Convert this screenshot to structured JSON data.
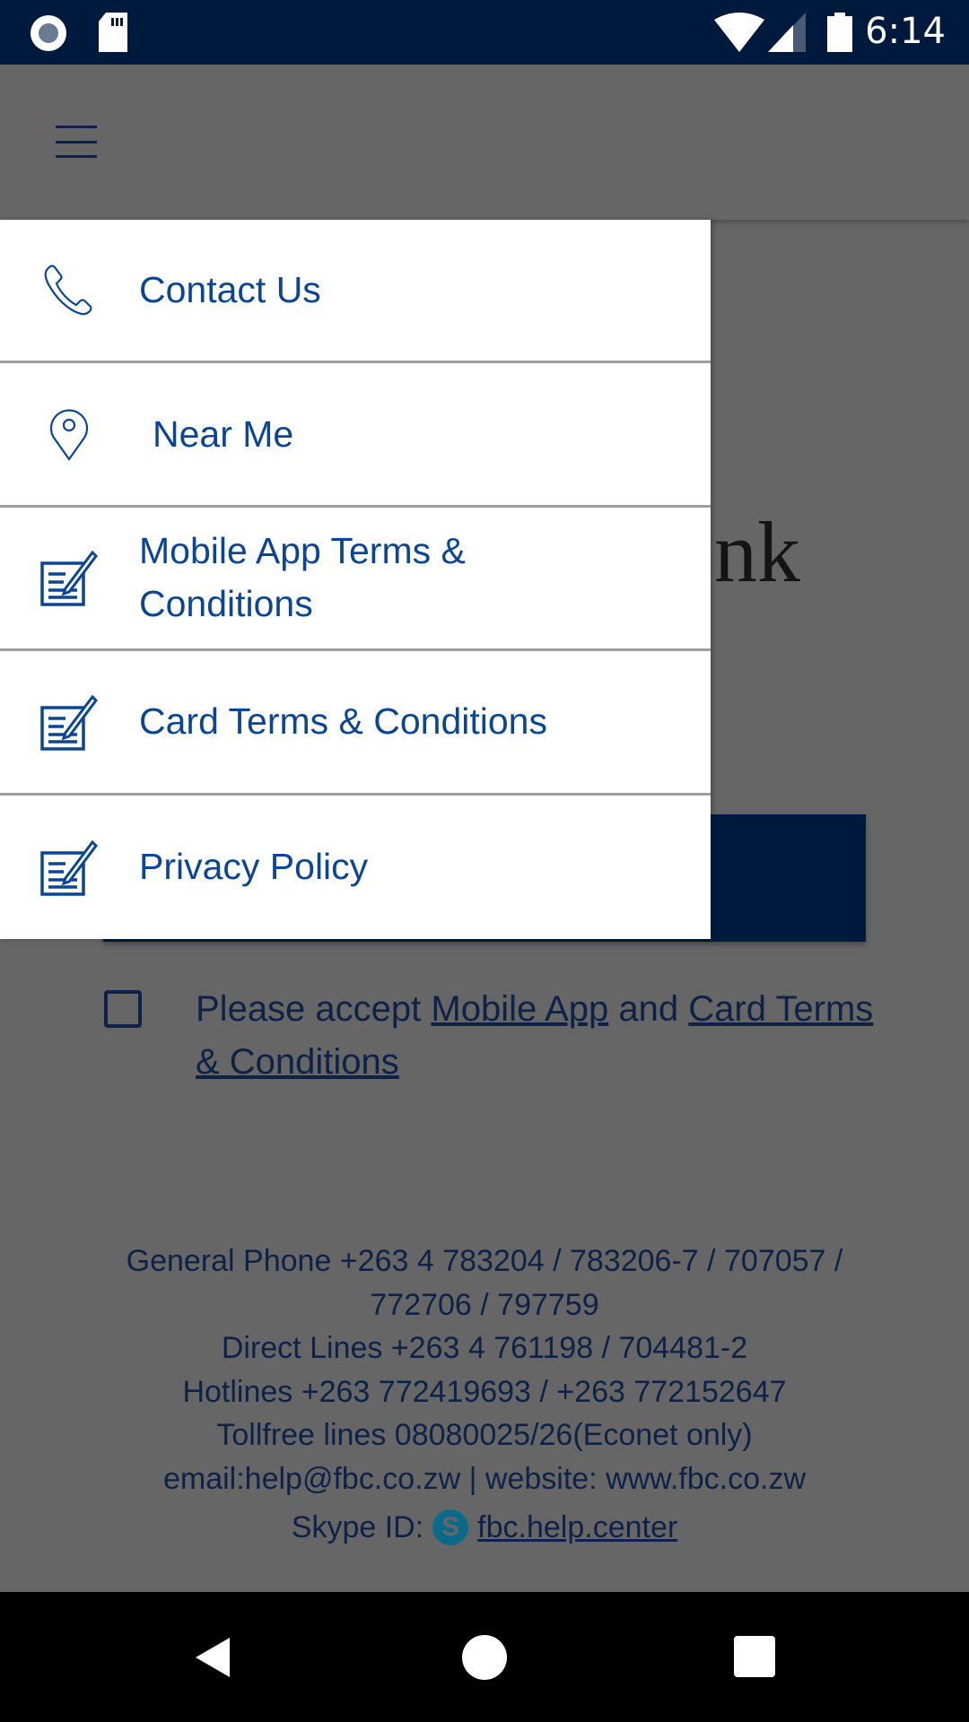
{
  "status_bar": {
    "time": "6:14",
    "icons": [
      "camera-record-icon",
      "sd-card-icon",
      "wifi-icon",
      "signal-icon",
      "battery-icon"
    ]
  },
  "toolbar": {
    "menu_icon": "hamburger-icon"
  },
  "background": {
    "title_fragment": "nk",
    "accept_prefix": "Please accept ",
    "accept_link1": "Mobile App",
    "accept_mid": " and ",
    "accept_link2": "Card Terms & Conditions"
  },
  "footer": {
    "lines": [
      "General Phone +263 4 783204 / 783206-7 / 707057 / 772706 / 797759",
      "Direct Lines +263 4 761198 / 704481-2",
      "Hotlines +263 772419693 / +263 772152647",
      "Tollfree lines 08080025/26(Econet only)",
      "email:help@fbc.co.zw | website: www.fbc.co.zw"
    ],
    "skype_label": "Skype ID:",
    "skype_id": "fbc.help.center"
  },
  "drawer": {
    "items": [
      {
        "label": "Contact Us",
        "icon": "phone-icon"
      },
      {
        "label": "Near Me",
        "icon": "location-pin-icon"
      },
      {
        "label": "Mobile App Terms & Conditions",
        "icon": "document-edit-icon"
      },
      {
        "label": "Card Terms & Conditions",
        "icon": "document-edit-icon"
      },
      {
        "label": "Privacy Policy",
        "icon": "document-edit-icon"
      }
    ]
  },
  "colors": {
    "status_bar": "#001a3d",
    "drawer_text": "#0b4595",
    "scrim_text": "#0d2246",
    "scrim": "#666666"
  }
}
